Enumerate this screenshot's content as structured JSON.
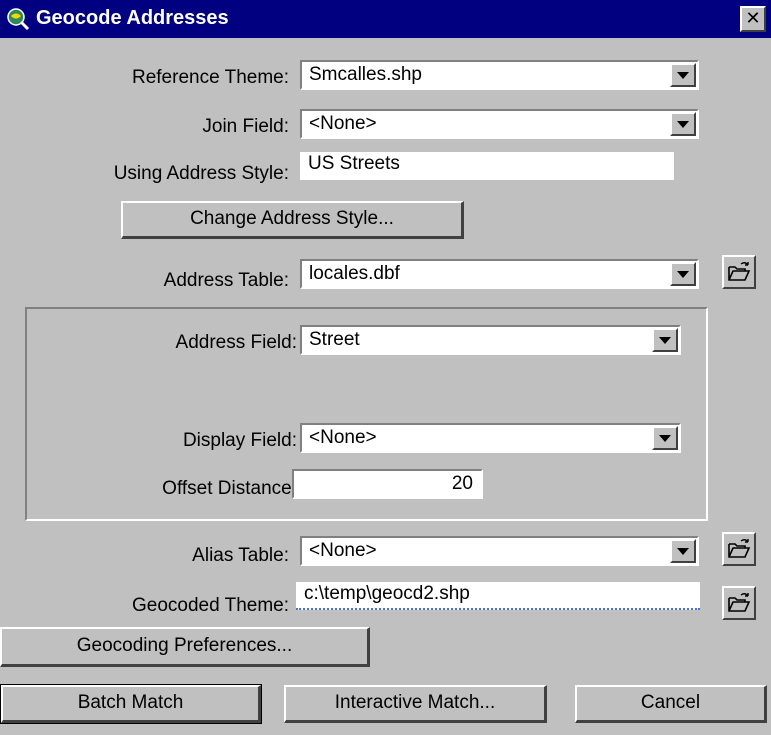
{
  "window": {
    "title": "Geocode Addresses",
    "close_label": "✕"
  },
  "reference_theme": {
    "label": "Reference Theme:",
    "value": "Smcalles.shp"
  },
  "join_field": {
    "label": "Join Field:",
    "value": "<None>"
  },
  "address_style": {
    "label": "Using Address Style:",
    "value": "US Streets"
  },
  "change_style_button": "Change Address Style...",
  "address_table": {
    "label": "Address Table:",
    "value": "locales.dbf"
  },
  "address_field": {
    "label": "Address Field:",
    "value": "Street"
  },
  "display_field": {
    "label": "Display Field:",
    "value": "<None>"
  },
  "offset_distance": {
    "label": "Offset Distance:",
    "value": "20"
  },
  "alias_table": {
    "label": "Alias Table:",
    "value": "<None>"
  },
  "geocoded_theme": {
    "label": "Geocoded Theme:",
    "value": "c:\\temp\\geocd2.shp"
  },
  "preferences_button": "Geocoding Preferences...",
  "buttons": {
    "batch": "Batch Match",
    "interactive": "Interactive Match...",
    "cancel": "Cancel"
  },
  "icons": {
    "open": "open-folder-icon",
    "app": "globe-magnifier-icon"
  }
}
